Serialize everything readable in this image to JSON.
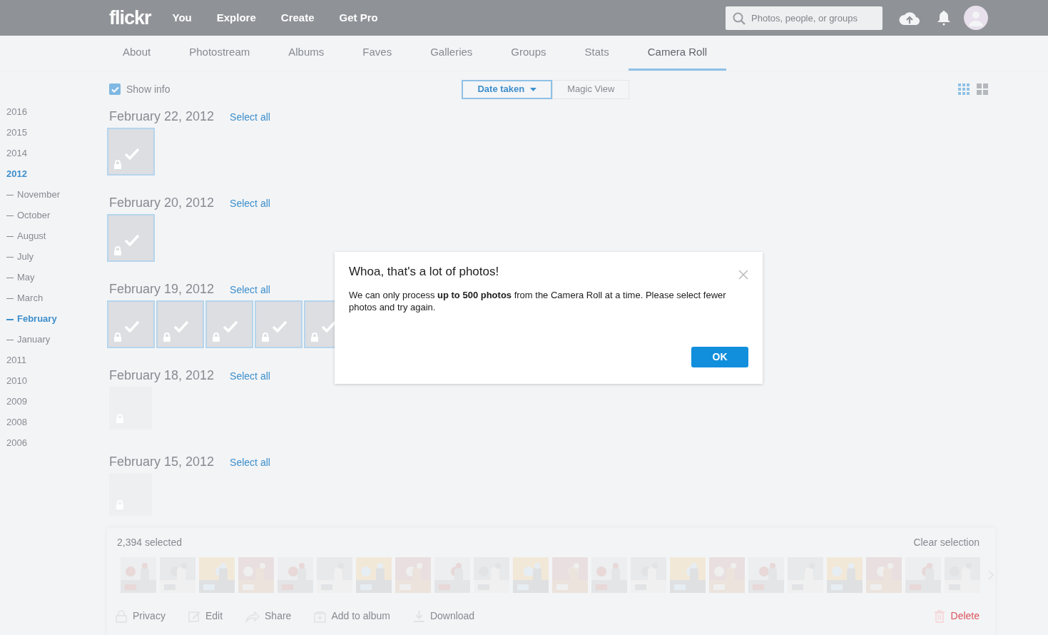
{
  "topbar": {
    "logo": "flickr",
    "nav": [
      "You",
      "Explore",
      "Create",
      "Get Pro"
    ],
    "search": {
      "placeholder": "Photos, people, or groups"
    }
  },
  "subnav": [
    {
      "label": "About",
      "selected": false
    },
    {
      "label": "Photostream",
      "selected": false
    },
    {
      "label": "Albums",
      "selected": false
    },
    {
      "label": "Faves",
      "selected": false
    },
    {
      "label": "Galleries",
      "selected": false
    },
    {
      "label": "Groups",
      "selected": false
    },
    {
      "label": "Stats",
      "selected": false
    },
    {
      "label": "Camera Roll",
      "selected": true
    }
  ],
  "toolbar": {
    "show_info": {
      "label": "Show info",
      "checked": true
    },
    "sort": [
      {
        "label": "Date taken",
        "selected": true,
        "kind": "dropdown"
      },
      {
        "label": "Magic View",
        "selected": false,
        "kind": "button"
      }
    ],
    "view_modes": [
      {
        "kind": "small-grid",
        "selected": true
      },
      {
        "kind": "large-grid",
        "selected": false
      }
    ]
  },
  "sidebar": [
    {
      "label": "2016",
      "selected": false
    },
    {
      "label": "2015",
      "selected": false
    },
    {
      "label": "2014",
      "selected": false
    },
    {
      "label": "2012",
      "selected": true,
      "children": [
        {
          "label": "November",
          "selected": false
        },
        {
          "label": "October",
          "selected": false
        },
        {
          "label": "August",
          "selected": false
        },
        {
          "label": "July",
          "selected": false
        },
        {
          "label": "May",
          "selected": false
        },
        {
          "label": "March",
          "selected": false
        },
        {
          "label": "February",
          "selected": true
        },
        {
          "label": "January",
          "selected": false
        }
      ]
    },
    {
      "label": "2011",
      "selected": false
    },
    {
      "label": "2010",
      "selected": false
    },
    {
      "label": "2009",
      "selected": false
    },
    {
      "label": "2008",
      "selected": false
    },
    {
      "label": "2006",
      "selected": false
    }
  ],
  "groups": [
    {
      "date": "February 22, 2012",
      "action": "Select all",
      "photos": [
        {
          "selected": true
        }
      ]
    },
    {
      "date": "February 20, 2012",
      "action": "Select all",
      "photos": [
        {
          "selected": true
        }
      ]
    },
    {
      "date": "February 19, 2012",
      "action": "Select all",
      "photos": [
        {
          "selected": true
        },
        {
          "selected": true
        },
        {
          "selected": true
        },
        {
          "selected": true
        },
        {
          "selected": true
        }
      ]
    },
    {
      "date": "February 18, 2012",
      "action": "Select all",
      "photos": [
        {
          "selected": false
        }
      ]
    },
    {
      "date": "February 15, 2012",
      "action": "Select all",
      "photos": [
        {
          "selected": false
        }
      ]
    }
  ],
  "tray": {
    "count": "2,394 selected",
    "clear": "Clear selection",
    "actions": [
      {
        "label": "Privacy",
        "kind": "privacy"
      },
      {
        "label": "Edit",
        "kind": "edit"
      },
      {
        "label": "Share",
        "kind": "share"
      },
      {
        "label": "Add to album",
        "kind": "album"
      },
      {
        "label": "Download",
        "kind": "download"
      },
      {
        "label": "Delete",
        "kind": "delete"
      }
    ]
  },
  "dialog": {
    "title": "Whoa, that's a lot of photos!",
    "message": "We can only process **up to 500 photos** from the Camera Roll at a time. Please select fewer photos and try again.",
    "button": "OK"
  }
}
